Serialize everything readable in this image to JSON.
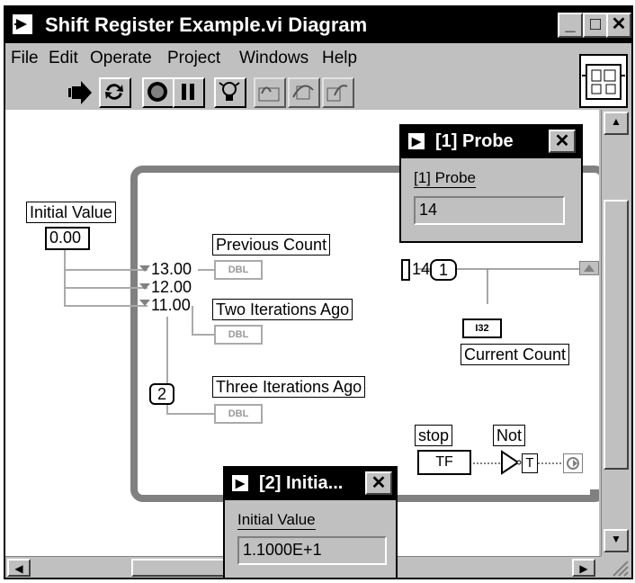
{
  "window": {
    "title": "Shift Register Example.vi Diagram",
    "buttons": [
      "_",
      "□",
      "✕"
    ]
  },
  "menu": [
    "File",
    "Edit",
    "Operate",
    "Project",
    "Windows",
    "Help"
  ],
  "toolbar": [
    "run-arrow",
    "run-continuously",
    "abort",
    "pause",
    "highlight-execution",
    "step-into",
    "step-over",
    "step-out"
  ],
  "diagram": {
    "initial_value_label": "Initial Value",
    "initial_value": "0.00",
    "sr_values": [
      "13.00",
      "12.00",
      "11.00"
    ],
    "previous_count": "Previous Count",
    "two_iterations_ago": "Two Iterations Ago",
    "three_iterations_ago": "Three Iterations Ago",
    "loop_count_constant": "2",
    "iteration_value": "14",
    "increment_constant": "1",
    "current_count": "Current Count",
    "i32_tag": "I32",
    "dbl_tag": "DBL",
    "stop_label": "stop",
    "not_label": "Not",
    "tf_tag": "TF",
    "t_tag": "T"
  },
  "probe1": {
    "title": "[1] Probe",
    "label": "[1] Probe",
    "value": "14"
  },
  "probe2": {
    "title": "[2] Initia...",
    "label": "Initial Value",
    "value": "1.1000E+1"
  }
}
